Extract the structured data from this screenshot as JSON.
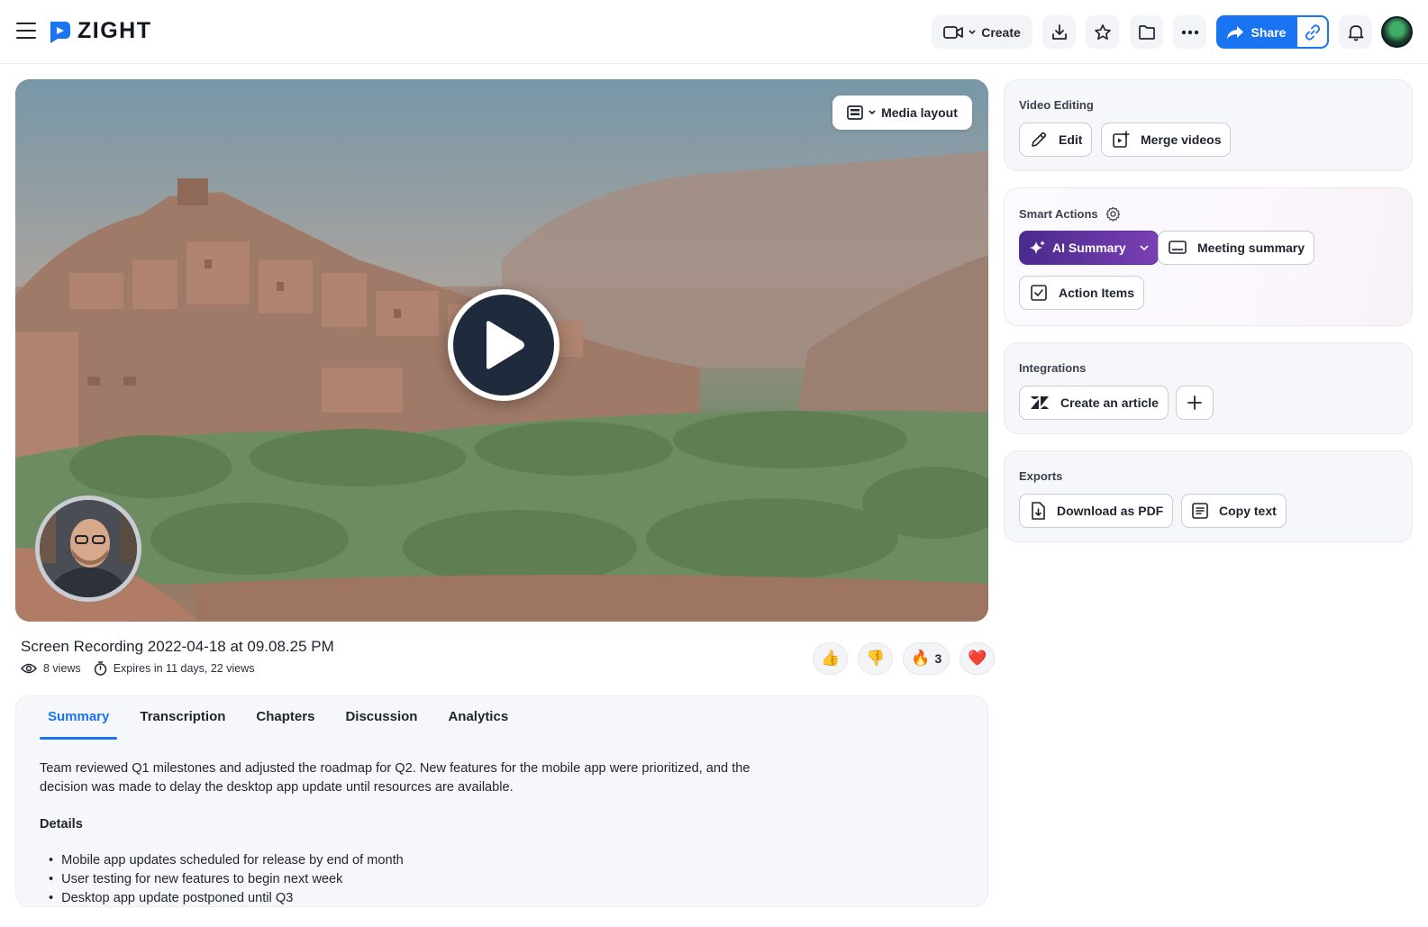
{
  "app": {
    "logo_text": "ZIGHT"
  },
  "toolbar": {
    "create_label": "Create",
    "share_label": "Share"
  },
  "video": {
    "media_layout_label": "Media layout",
    "title": "Screen Recording 2022-04-18 at 09.08.25 PM",
    "views": "8 views",
    "expiry": "Expires in 11 days, 22 views"
  },
  "reactions": [
    {
      "emoji": "👍",
      "count": ""
    },
    {
      "emoji": "👎",
      "count": ""
    },
    {
      "emoji": "🔥",
      "count": "3"
    },
    {
      "emoji": "❤️",
      "count": ""
    }
  ],
  "tabs": [
    {
      "label": "Summary",
      "active": true
    },
    {
      "label": "Transcription",
      "active": false
    },
    {
      "label": "Chapters",
      "active": false
    },
    {
      "label": "Discussion",
      "active": false
    },
    {
      "label": "Analytics",
      "active": false
    }
  ],
  "summary": {
    "text": "Team reviewed Q1 milestones and adjusted the roadmap for Q2. New features for the mobile app were prioritized, and the decision was made to delay the desktop app update until resources are available.",
    "details_heading": "Details",
    "bullets": [
      "Mobile app updates scheduled for release by end of month",
      "User testing for new features to begin next week",
      "Desktop app update postponed until Q3"
    ]
  },
  "sidebar": {
    "video_editing": {
      "title": "Video Editing",
      "edit_label": "Edit",
      "merge_label": "Merge videos"
    },
    "smart_actions": {
      "title": "Smart Actions",
      "ai_summary_label": "AI Summary",
      "meeting_summary_label": "Meeting summary",
      "action_items_label": "Action Items"
    },
    "integrations": {
      "title": "Integrations",
      "create_article_label": "Create an article"
    },
    "exports": {
      "title": "Exports",
      "download_pdf_label": "Download as PDF",
      "copy_text_label": "Copy text"
    }
  },
  "colors": {
    "accent": "#1a73f0",
    "ai_gradient_start": "#4a2a8c",
    "ai_gradient_end": "#7a3fb3"
  }
}
